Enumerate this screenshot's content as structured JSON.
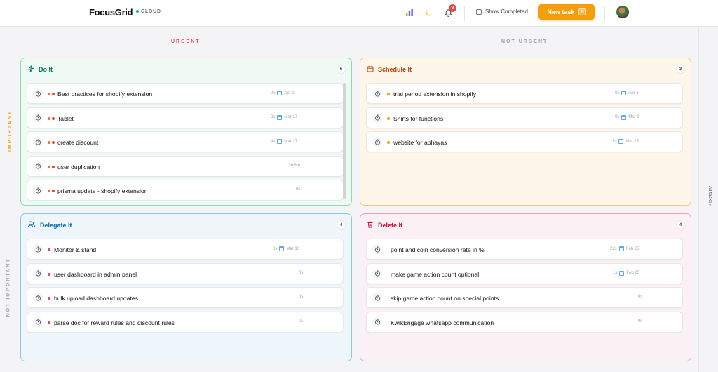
{
  "header": {
    "brand": "FocusGrid",
    "cloud_label": "CLOUD",
    "notification_count": "9",
    "show_completed_label": "Show Completed",
    "new_task_label": "New task",
    "new_task_shortcut": "N"
  },
  "axes": {
    "col_urgent": "URGENT",
    "col_not_urgent": "NOT URGENT",
    "row_important": "IMPORTANT",
    "row_not_important": "NOT IMPORTANT"
  },
  "quadrants": {
    "do": {
      "title": "Do It",
      "count": "5",
      "color": "#047857",
      "tasks": [
        {
          "name": "Best practices for shopify extension",
          "time": "0s",
          "date": "Apr 2"
        },
        {
          "name": "Tablet",
          "time": "0s",
          "date": "Mar 17"
        },
        {
          "name": "create discount",
          "time": "4s",
          "date": "Mar 17"
        },
        {
          "name": "user duplication",
          "time": "13h 8m",
          "date": ""
        },
        {
          "name": "prisma update - shopify extension",
          "time": "0s",
          "date": ""
        }
      ]
    },
    "schedule": {
      "title": "Schedule It",
      "count": "3",
      "color": "#c2410c",
      "tasks": [
        {
          "name": "trial period extension in shopify",
          "time": "0s",
          "date": "Apr 3"
        },
        {
          "name": "Shirts for functions",
          "time": "0s",
          "date": "Mar 9"
        },
        {
          "name": "website for abhayas",
          "time": "1s",
          "date": "Mar 15"
        }
      ]
    },
    "delegate": {
      "title": "Delegate It",
      "count": "4",
      "color": "#0369a1",
      "tasks": [
        {
          "name": "Monitor & stand",
          "time": "0s",
          "date": "Mar 10"
        },
        {
          "name": "user dashboard in admin panel",
          "time": "0s",
          "date": ""
        },
        {
          "name": "bulk upload dashboard updates",
          "time": "0s",
          "date": ""
        },
        {
          "name": "parse doc for reward rules and discount rules",
          "time": "0s",
          "date": ""
        }
      ]
    },
    "delete": {
      "title": "Delete It",
      "count": "4",
      "color": "#be123c",
      "tasks": [
        {
          "name": "point and coin conversion rate in %",
          "time": "22s",
          "date": "Feb 25"
        },
        {
          "name": "make game action count optional",
          "time": "1s",
          "date": "Feb 25"
        },
        {
          "name": "skip game action count on special points",
          "time": "0s",
          "date": ""
        },
        {
          "name": "KwikEngage whatsapp communication",
          "time": "0s",
          "date": ""
        }
      ]
    }
  },
  "rail": {
    "all_tasks_label": "All tasks"
  },
  "colors": {
    "urgent": "#f43f5e",
    "not_urgent": "#9ca3af",
    "important": "#f59e0b",
    "not_important": "#9ca3af",
    "accent": "#f59e0b"
  }
}
